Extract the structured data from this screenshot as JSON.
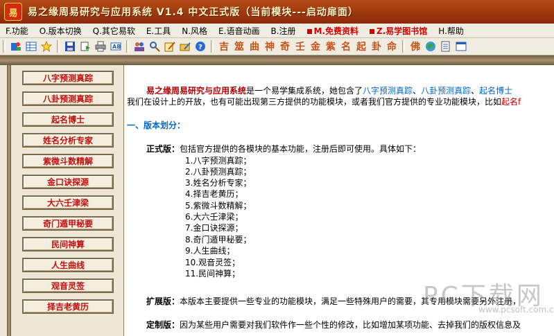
{
  "window": {
    "logo_char": "易",
    "title": "易之缘周易研究与应用系统 V1.4 中文正式版（当前模块---启动扉面）"
  },
  "menu": [
    {
      "label": "F.功能"
    },
    {
      "label": "O.版本切换"
    },
    {
      "label": "Q.其它易软"
    },
    {
      "label": "E.工具"
    },
    {
      "label": "N.风格"
    },
    {
      "label": "E.语音动画"
    },
    {
      "label": "B.注册"
    },
    {
      "label": "M.免费资料"
    },
    {
      "label": "Z.易学图书馆"
    },
    {
      "label": "H.帮助"
    }
  ],
  "toolbar": {
    "chars": [
      "吉",
      "筮",
      "曲",
      "神",
      "奇",
      "壬",
      "金",
      "紫",
      "名",
      "起",
      "卦",
      "命"
    ],
    "extra_char": "佛"
  },
  "sidebar": {
    "items": [
      {
        "label": "八字预测真踪"
      },
      {
        "label": "八卦预测真踪"
      },
      {
        "label": "起名博士"
      },
      {
        "label": "姓名分析专家"
      },
      {
        "label": "紫微斗数精解"
      },
      {
        "label": "金口诀探源"
      },
      {
        "label": "大六壬津梁"
      },
      {
        "label": "奇门遁甲秘要"
      },
      {
        "label": "民间神算"
      },
      {
        "label": "人生曲线"
      },
      {
        "label": "观音灵签"
      },
      {
        "label": "择吉老黄历"
      }
    ]
  },
  "content": {
    "intro_name": "易之缘周易研究与应用系统",
    "intro_text": "是一个易学集成系统，她包含了",
    "intro_link1": "八字预测真踪",
    "sep1": "、",
    "intro_link2": "八卦预测真踪",
    "sep2": "、",
    "intro_link3": "起名博士",
    "line2": "我们在设计上的开放，也有可能出现第三方提供的功能模块，或者我们官方提供的专业功能模块，比如",
    "line2_red": "起名f",
    "section1": "一、版本划分：",
    "official_label": "正式版：",
    "official_text": "包括官方提供的各模块的基本功能，注册后即可使用。具体如下：",
    "modules": [
      "1.八字预测真踪；",
      "2.八卦预测真踪；",
      "3.姓名分析专家；",
      "4.择吉老黄历；",
      "5.紫微斗数精解；",
      "6.大六壬津梁；",
      "7.金口诀探源；",
      "8.奇门遁甲秘要；",
      "9.人生曲线；",
      "10.观音灵签；",
      "11.民间神算；"
    ],
    "ext_label": "扩展版：",
    "ext_text": "本版本主要提供一些专业的功能模块，满足一些特殊用户的需要，其专用模块需要另外注册，",
    "custom_label": "定制版：",
    "custom_text": "因为某些用户需要对我们软件作一些个性的修改，比如增加某项功能、去掉我们的版权信息及"
  },
  "watermark": {
    "text": "PC下载网",
    "url": "www.pcsoft.com.cn"
  }
}
